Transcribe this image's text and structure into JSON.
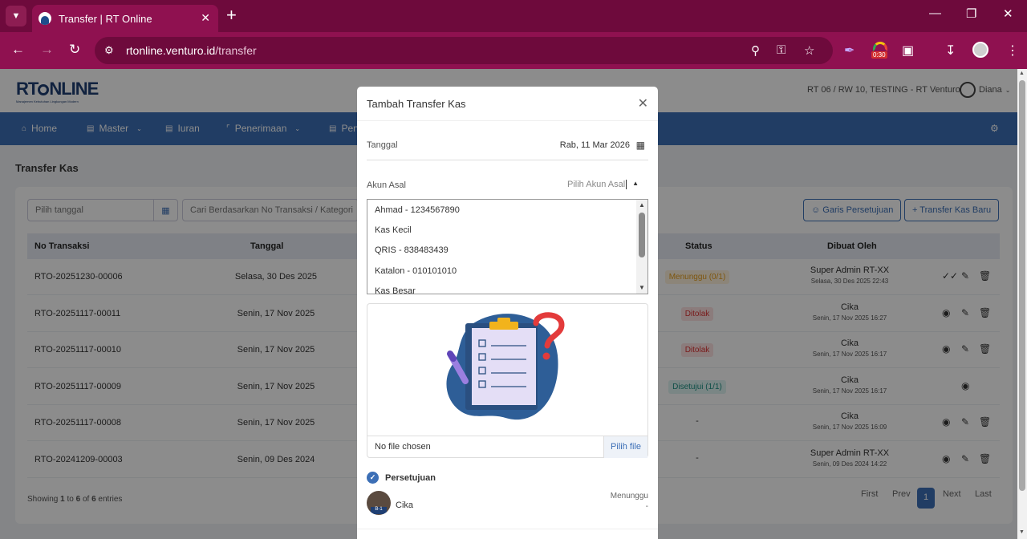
{
  "browser": {
    "tab_title": "Transfer | RT Online",
    "url_host": "rtonline.venturo.id",
    "url_path": "/transfer",
    "timer_badge": "0:30"
  },
  "app": {
    "logo_text": "RT",
    "logo_text2": "NLINE",
    "logo_sub": "Manajemen Kebutuhan Lingkungan Modern",
    "org": "RT 06 / RW 10, TESTING - RT Venturo",
    "user": "Diana",
    "nav": [
      "Home",
      "Master",
      "Iuran",
      "Penerimaan",
      "Pen"
    ],
    "page_title": "Transfer Kas"
  },
  "filters": {
    "date_placeholder": "Pilih tanggal",
    "search_placeholder": "Cari Berdasarkan No Transaksi / Kategori",
    "approval_btn": "Garis Persetujuan",
    "new_btn": "+ Transfer Kas Baru"
  },
  "table": {
    "headers": [
      "No Transaksi",
      "Tanggal",
      "Status",
      "Dibuat Oleh"
    ],
    "rows": [
      {
        "no": "RTO-20251230-00006",
        "tanggal": "Selasa, 30 Des 2025",
        "status": "Menunggu (0/1)",
        "by": "Super Admin RT-XX",
        "by_time": "Selasa, 30 Des 2025 22:43"
      },
      {
        "no": "RTO-20251117-00011",
        "tanggal": "Senin, 17 Nov 2025",
        "status": "Ditolak",
        "by": "Cika",
        "by_time": "Senin, 17 Nov 2025 16:27"
      },
      {
        "no": "RTO-20251117-00010",
        "tanggal": "Senin, 17 Nov 2025",
        "status": "Ditolak",
        "by": "Cika",
        "by_time": "Senin, 17 Nov 2025 16:17"
      },
      {
        "no": "RTO-20251117-00009",
        "tanggal": "Senin, 17 Nov 2025",
        "status": "Disetujui (1/1)",
        "by": "Cika",
        "by_time": "Senin, 17 Nov 2025 16:17"
      },
      {
        "no": "RTO-20251117-00008",
        "tanggal": "Senin, 17 Nov 2025",
        "status": "-",
        "by": "Cika",
        "by_time": "Senin, 17 Nov 2025 16:09"
      },
      {
        "no": "RTO-20241209-00003",
        "tanggal": "Senin, 09 Des 2024",
        "status": "-",
        "by": "Super Admin RT-XX",
        "by_time": "Senin, 09 Des 2024 14:22"
      }
    ],
    "footer_prefix": "Showing ",
    "footer_from": "1",
    "footer_mid1": " to ",
    "footer_to": "6",
    "footer_mid2": " of ",
    "footer_total": "6",
    "footer_suffix": " entries",
    "pager": [
      "First",
      "Prev",
      "1",
      "Next",
      "Last"
    ]
  },
  "modal": {
    "title": "Tambah Transfer Kas",
    "tanggal_label": "Tanggal",
    "tanggal_value": "Rab, 11 Mar 2026",
    "akun_label": "Akun Asal",
    "akun_placeholder": "Pilih Akun Asal",
    "akun_options": [
      "Ahmad - 1234567890",
      "Kas Kecil",
      "QRIS - 838483439",
      "Katalon - 010101010",
      "Kas Besar"
    ],
    "file_name": "No file chosen",
    "file_button": "Pilih file",
    "approval_title": "Persetujuan",
    "approver_name": "Cika",
    "approver_status": "Menunggu",
    "approver_date": "-",
    "avatar_tag": "B-1"
  }
}
